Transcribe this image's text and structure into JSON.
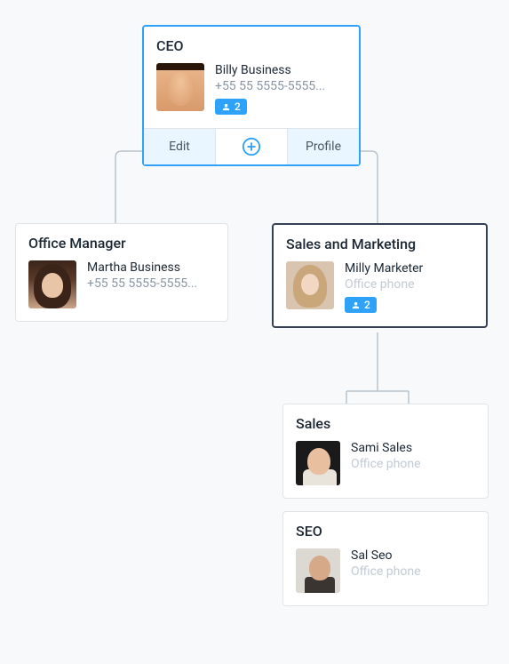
{
  "ceo": {
    "title": "CEO",
    "name": "Billy Business",
    "phone": "+55 55 5555-5555...",
    "badge_count": "2",
    "actions": {
      "edit": "Edit",
      "profile": "Profile"
    }
  },
  "office_manager": {
    "title": "Office Manager",
    "name": "Martha Business",
    "phone": "+55 55 5555-5555..."
  },
  "sales_marketing": {
    "title": "Sales and Marketing",
    "name": "Milly Marketer",
    "sub": "Office phone",
    "badge_count": "2"
  },
  "sales": {
    "title": "Sales",
    "name": "Sami Sales",
    "sub": "Office phone"
  },
  "seo": {
    "title": "SEO",
    "name": "Sal Seo",
    "sub": "Office phone"
  }
}
